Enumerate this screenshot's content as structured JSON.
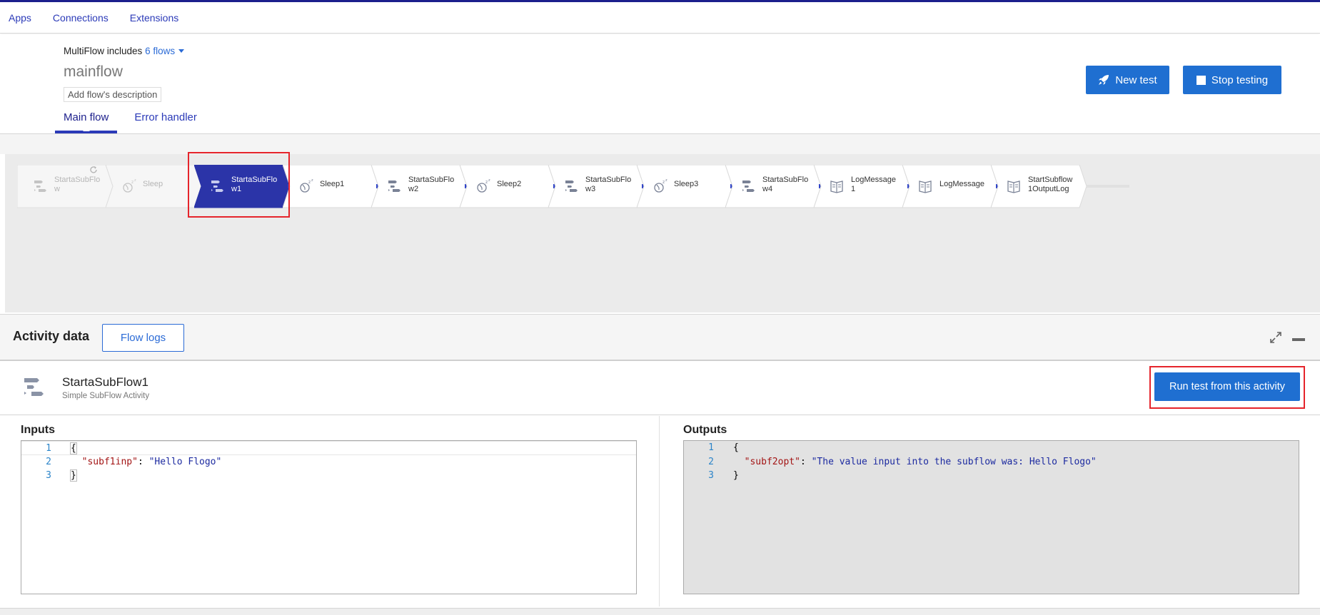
{
  "topnav": {
    "apps": "Apps",
    "connections": "Connections",
    "extensions": "Extensions"
  },
  "header": {
    "multiflow_prefix": "MultiFlow includes",
    "multiflow_count": "6 flows",
    "flow_name": "mainflow",
    "description_placeholder": "Add flow's description",
    "tabs": {
      "main": "Main flow",
      "error": "Error handler"
    },
    "new_test": "New test",
    "stop_testing": "Stop testing"
  },
  "colors": {
    "accent": "#1f6fd1",
    "active_tile": "#2b34a8",
    "highlight": "#e5242b",
    "brand": "#1c1f8c"
  },
  "tiles": [
    {
      "label_l1": "StartaSubFlo",
      "label_l2": "w",
      "icon": "subflow-icon",
      "state": "dim"
    },
    {
      "label_l1": "Sleep",
      "label_l2": "",
      "icon": "sleep-icon",
      "state": "dim"
    },
    {
      "label_l1": "StartaSubFlo",
      "label_l2": "w1",
      "icon": "subflow-icon",
      "state": "active"
    },
    {
      "label_l1": "Sleep1",
      "label_l2": "",
      "icon": "sleep-icon",
      "state": "normal"
    },
    {
      "label_l1": "StartaSubFlo",
      "label_l2": "w2",
      "icon": "subflow-icon",
      "state": "normal"
    },
    {
      "label_l1": "Sleep2",
      "label_l2": "",
      "icon": "sleep-icon",
      "state": "normal"
    },
    {
      "label_l1": "StartaSubFlo",
      "label_l2": "w3",
      "icon": "subflow-icon",
      "state": "normal"
    },
    {
      "label_l1": "Sleep3",
      "label_l2": "",
      "icon": "sleep-icon",
      "state": "normal"
    },
    {
      "label_l1": "StartaSubFlo",
      "label_l2": "w4",
      "icon": "subflow-icon",
      "state": "normal"
    },
    {
      "label_l1": "LogMessage",
      "label_l2": "1",
      "icon": "log-icon",
      "state": "normal"
    },
    {
      "label_l1": "LogMessage",
      "label_l2": "",
      "icon": "log-icon",
      "state": "normal"
    },
    {
      "label_l1": "StartSubflow",
      "label_l2": "1OutputLog",
      "icon": "log-icon",
      "state": "normal"
    }
  ],
  "activity": {
    "section_title": "Activity data",
    "flow_logs": "Flow logs",
    "name": "StartaSubFlow1",
    "type": "Simple SubFlow Activity",
    "run_button": "Run test from this activity"
  },
  "inputs": {
    "title": "Inputs",
    "lines": [
      {
        "n": "1",
        "open": "{"
      },
      {
        "n": "2",
        "key": "\"subf1inp\"",
        "sep": ": ",
        "val": "\"Hello Flogo\""
      },
      {
        "n": "3",
        "close": "}"
      }
    ]
  },
  "outputs": {
    "title": "Outputs",
    "lines": [
      {
        "n": "1",
        "open": "{"
      },
      {
        "n": "2",
        "key": "\"subf2opt\"",
        "sep": ": ",
        "val": "\"The value input into the subflow was: Hello Flogo\""
      },
      {
        "n": "3",
        "close": "}"
      }
    ]
  }
}
